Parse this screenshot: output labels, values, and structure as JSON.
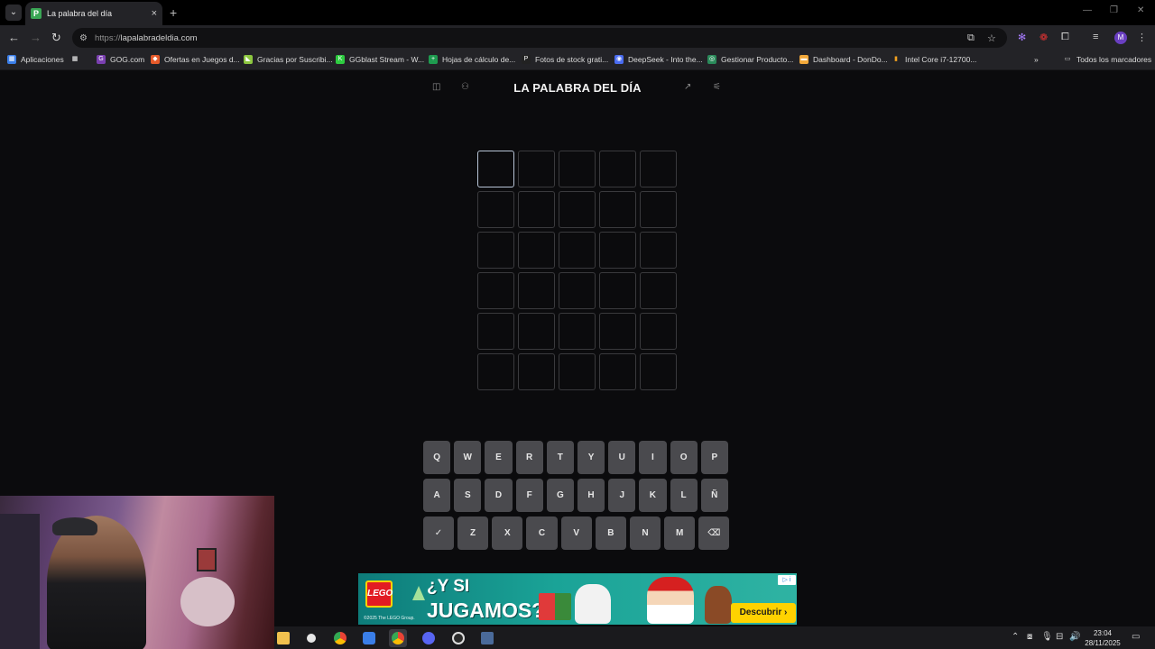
{
  "browser": {
    "tab_title": "La palabra del día",
    "tab_favicon_letter": "P",
    "url_scheme": "https://",
    "url_host": "lapalabradeldia.com",
    "avatar_letter": "M"
  },
  "bookmarks": [
    {
      "label": "Aplicaciones",
      "color": "#3a7ee8"
    },
    {
      "label": "GOG.com",
      "color": "#7a3fb0"
    },
    {
      "label": "Ofertas en Juegos d...",
      "color": "#e65a2a"
    },
    {
      "label": "Gracias por Suscribi...",
      "color": "#8cc63f"
    },
    {
      "label": "GGblast Stream - W...",
      "color": "#2ecc40"
    },
    {
      "label": "Hojas de cálculo de...",
      "color": "#1e9b4f"
    },
    {
      "label": "Fotos de stock grati...",
      "color": "#222222"
    },
    {
      "label": "DeepSeek - Into the...",
      "color": "#4a6cf0"
    },
    {
      "label": "Gestionar Producto...",
      "color": "#2a8a5a"
    },
    {
      "label": "Dashboard - DonDo...",
      "color": "#f2a83a"
    },
    {
      "label": "Intel Core i7-12700...",
      "color": "#f0a020"
    }
  ],
  "bookmarks_folder": "Todos los marcadores",
  "game": {
    "title": "LA PALABRA DEL DÍA",
    "rows": 6,
    "cols": 5,
    "active_cell": [
      0,
      0
    ]
  },
  "keyboard": {
    "row1": [
      "Q",
      "W",
      "E",
      "R",
      "T",
      "Y",
      "U",
      "I",
      "O",
      "P"
    ],
    "row2": [
      "A",
      "S",
      "D",
      "F",
      "G",
      "H",
      "J",
      "K",
      "L",
      "Ñ"
    ],
    "row3": [
      "✓",
      "Z",
      "X",
      "C",
      "V",
      "B",
      "N",
      "M",
      "⌫"
    ]
  },
  "ad": {
    "brand": "LEGO",
    "headline_1": "¿Y SI",
    "headline_2": "JUGAMOS?",
    "legal": "©2025 The LEGO Group.",
    "cta": "Descubrir ›"
  },
  "taskbar": {
    "time": "23:04",
    "date": "28/11/2025"
  },
  "colors": {
    "page_bg": "#0b0b0d",
    "cell_border": "#3a3a3d",
    "active_cell_border": "#b7c4d6",
    "key_bg": "#4a4a4e",
    "ad_bg": "#1aa397",
    "cta_bg": "#ffd200"
  }
}
